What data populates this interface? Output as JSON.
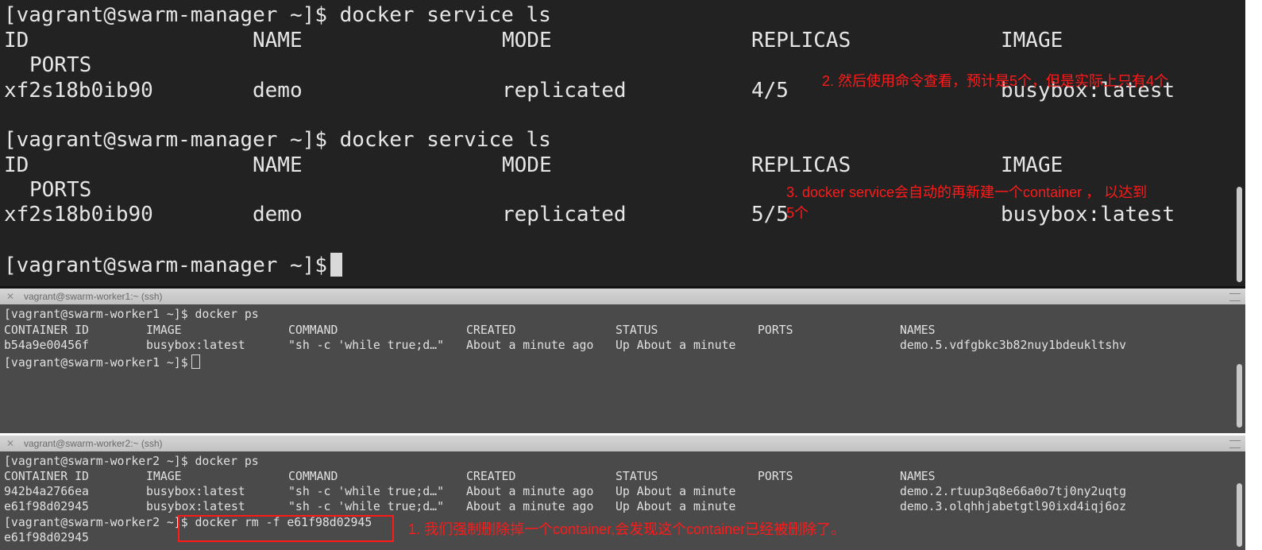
{
  "top_terminal": {
    "blocks": [
      {
        "prompt": "[vagrant@swarm-manager ~]$ docker service ls",
        "headers": [
          "ID",
          "NAME",
          "MODE",
          "REPLICAS",
          "IMAGE"
        ],
        "headers_wrap": "PORTS",
        "row": [
          "xf2s18b0ib90",
          "demo",
          "replicated",
          "4/5",
          "busybox:latest"
        ]
      },
      {
        "prompt": "[vagrant@swarm-manager ~]$ docker service ls",
        "headers": [
          "ID",
          "NAME",
          "MODE",
          "REPLICAS",
          "IMAGE"
        ],
        "headers_wrap": "PORTS",
        "row": [
          "xf2s18b0ib90",
          "demo",
          "replicated",
          "5/5",
          "busybox:latest"
        ]
      }
    ],
    "final_prompt": "[vagrant@swarm-manager ~]$"
  },
  "worker1": {
    "title": "vagrant@swarm-worker1:~ (ssh)",
    "prompt": "[vagrant@swarm-worker1 ~]$ docker ps",
    "headers": [
      "CONTAINER ID",
      "IMAGE",
      "COMMAND",
      "CREATED",
      "STATUS",
      "PORTS",
      "NAMES"
    ],
    "rows": [
      [
        "b54a9e00456f",
        "busybox:latest",
        "\"sh -c 'while true;d…\"",
        "About a minute ago",
        "Up About a minute",
        "",
        "demo.5.vdfgbkc3b82nuy1bdeukltshv"
      ]
    ],
    "final_prompt": "[vagrant@swarm-worker1 ~]$"
  },
  "worker2": {
    "title": "vagrant@swarm-worker2:~ (ssh)",
    "prompt": "[vagrant@swarm-worker2 ~]$ docker ps",
    "headers": [
      "CONTAINER ID",
      "IMAGE",
      "COMMAND",
      "CREATED",
      "STATUS",
      "PORTS",
      "NAMES"
    ],
    "rows": [
      [
        "942b4a2766ea",
        "busybox:latest",
        "\"sh -c 'while true;d…\"",
        "About a minute ago",
        "Up About a minute",
        "",
        "demo.2.rtuup3q8e66a0o7tj0ny2uqtg"
      ],
      [
        "e61f98d02945",
        "busybox:latest",
        "\"sh -c 'while true;d…\"",
        "About a minute ago",
        "Up About a minute",
        "",
        "demo.3.olqhhjabetgtl90ixd4iqj6oz"
      ]
    ],
    "rm_prompt": "[vagrant@swarm-worker2 ~]$ docker rm -f e61f98d02945",
    "rm_output": "e61f98d02945"
  },
  "annotations": {
    "note1": "1. 我们强制删除掉一个container,会发现这个container已经被删除了。",
    "note2": "2. 然后使用命令查看，预计是5个，但是实际上只有4个",
    "note3_line1": "3. docker service会自动的再新建一个container ， 以达到",
    "note3_line2": "5个",
    "color": "#ff1a1a"
  }
}
